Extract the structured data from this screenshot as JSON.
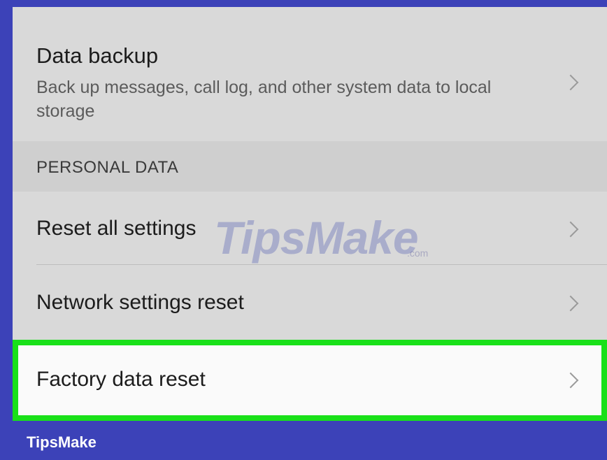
{
  "settings": {
    "backup": {
      "title": "Data backup",
      "subtitle": "Back up messages, call log, and other system data to local storage"
    },
    "section_header": "PERSONAL DATA",
    "items": [
      {
        "label": "Reset all settings"
      },
      {
        "label": "Network settings reset"
      },
      {
        "label": "Factory data reset",
        "highlighted": true
      }
    ]
  },
  "watermark": {
    "text": "TipsMake",
    "suffix": ".com"
  },
  "footer": {
    "brand": "TipsMake"
  },
  "colors": {
    "frame": "#3c42b8",
    "highlight": "#19e019",
    "row_background": "#d9d9d9",
    "highlighted_row_background": "#fafafa"
  },
  "icons": {
    "chevron": "chevron-right-icon"
  }
}
